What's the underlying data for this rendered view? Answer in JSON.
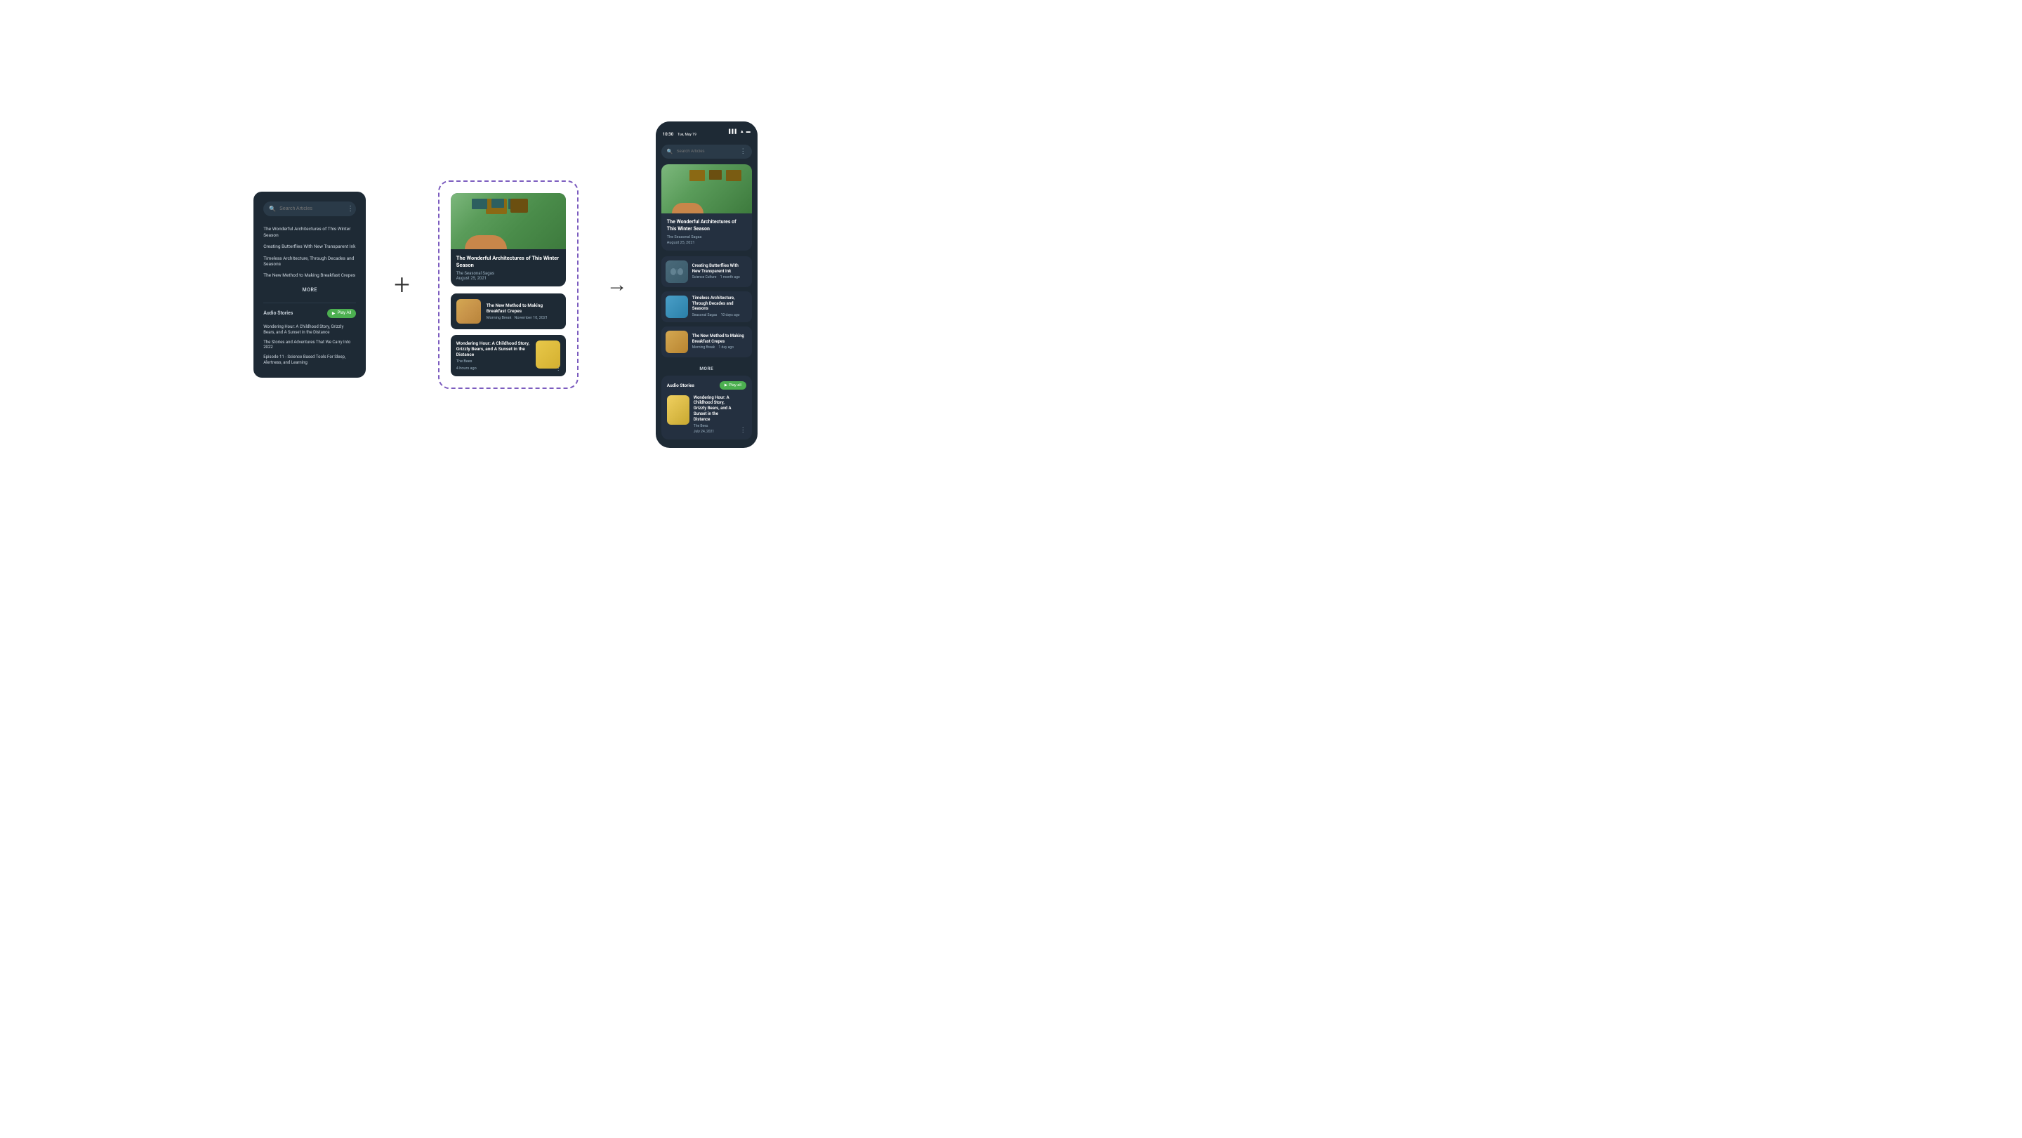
{
  "left": {
    "search_placeholder": "Search Articles",
    "articles": [
      "The Wonderful Architectures of This Winter Season",
      "Creating Butterflies With New Transparent Ink",
      "Timeless Architecture, Through Decades and Seasons",
      "The New Method to Making Breakfast Crepes"
    ],
    "more_label": "MORE",
    "audio": {
      "title": "Audio Stories",
      "play_all": "Play All",
      "items": [
        "Wondering Hour: A Childhood Story, Grizzly Bears, and A Sunset in the Distance",
        "The Stories and Adventures That We Carry Into 2022",
        "Episode 11 - Science Based Tools For Sleep, Alertness, and Learning"
      ]
    }
  },
  "center": {
    "featured": {
      "title": "The Wonderful Architectures of This Winter Season",
      "sub": "The Seasonal Sagas",
      "date": "August 25, 2021"
    },
    "card1": {
      "title": "The New Method to Making Breakfast Crepes",
      "source": "Morning Break",
      "date": "November 10, 2021"
    },
    "card2": {
      "title": "Wondering Hour: A Childhood Story, Grizzly Bears, and A Sunset in the Distance",
      "source": "The Bees",
      "time": "4 hours ago"
    }
  },
  "right": {
    "status": {
      "time": "10:30",
      "date": "Tue, May 19"
    },
    "search_placeholder": "Search Articles",
    "featured": {
      "title": "The Wonderful Architectures of This Winter Season",
      "sub": "The Seasonal Sagas",
      "date": "August 25, 2021"
    },
    "articles": [
      {
        "title": "Creating Butterflies With New Transparent Ink",
        "source": "Science Culture",
        "time": "1 month ago"
      },
      {
        "title": "Timeless Architecture, Through Decades and Seasons",
        "source": "Seasonal Sagas",
        "time": "10 days ago"
      },
      {
        "title": "The New Method to Making Breakfast Crepes",
        "source": "Morning Break",
        "time": "1 day ago"
      }
    ],
    "more_label": "MORE",
    "audio": {
      "title": "Audio Stories",
      "play_all": "Play all",
      "item": {
        "title": "Wondering Hour: A Childhood Story, Grizzly Bears, and A Sunset in the Distance",
        "source": "The Bees",
        "date": "July 24, 2021"
      }
    }
  },
  "plus_symbol": "+",
  "arrow_symbol": "→"
}
